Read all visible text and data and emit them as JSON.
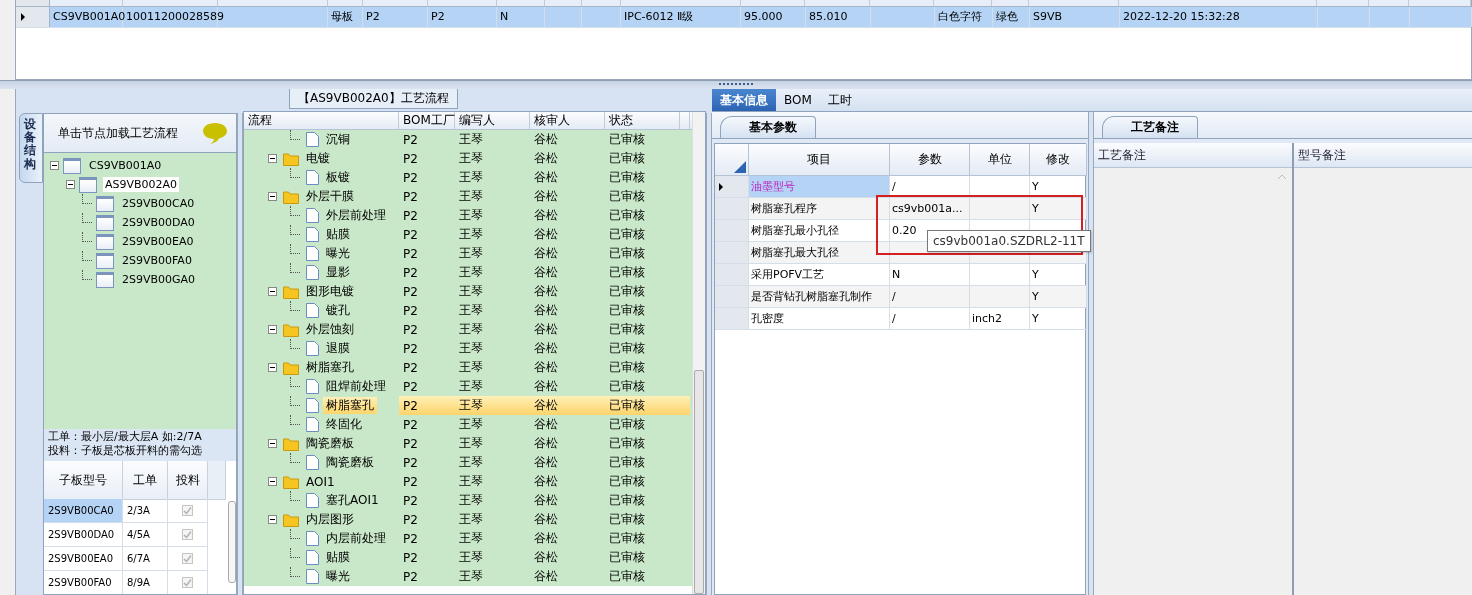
{
  "top_grid": {
    "rows": [
      {
        "selected": true,
        "cells": [
          "CS9VB001A0",
          "10011200028589",
          null,
          "母板",
          "P2",
          "P2",
          "N",
          null,
          null,
          "IPC-6012 Ⅱ级",
          "95.000",
          "85.010",
          null,
          "白色字符",
          "绿色",
          "S9VB",
          "2022-12-20 15:32:28",
          null,
          null,
          null
        ]
      }
    ]
  },
  "side_tab": {
    "label": "设备结构"
  },
  "structure": {
    "hint": "单击节点加载工艺流程",
    "tree": [
      {
        "label": "CS9VB001A0",
        "expanded": true,
        "selected": false,
        "children": [
          {
            "label": "AS9VB002A0",
            "expanded": true,
            "selected": true,
            "children": [
              {
                "label": "2S9VB00CA0",
                "selected": false
              },
              {
                "label": "2S9VB00DA0",
                "selected": false
              },
              {
                "label": "2S9VB00EA0",
                "selected": false
              },
              {
                "label": "2S9VB00FA0",
                "selected": false
              },
              {
                "label": "2S9VB00GA0",
                "selected": false
              }
            ]
          }
        ]
      }
    ],
    "notes": [
      "工单：最小层/最大层A 如:2/7A",
      "投料：子板是芯板开料的需勾选"
    ]
  },
  "sub_boards": {
    "columns": [
      "子板型号",
      "工单",
      "投料"
    ],
    "rows": [
      {
        "model": "2S9VB00CA0",
        "work_order": "2/3A",
        "checked": true,
        "selected": true
      },
      {
        "model": "2S9VB00DA0",
        "work_order": "4/5A",
        "checked": true,
        "selected": false
      },
      {
        "model": "2S9VB00EA0",
        "work_order": "6/7A",
        "checked": true,
        "selected": false
      },
      {
        "model": "2S9VB00FA0",
        "work_order": "8/9A",
        "checked": true,
        "selected": false
      }
    ]
  },
  "flow": {
    "title": "【AS9VB002A0】工艺流程",
    "columns": [
      "流程",
      "BOM工厂",
      "编写人",
      "核审人",
      "状态"
    ],
    "groups": [
      {
        "children": [
          {
            "name": "沉铜",
            "bom": "P2",
            "writer": "王琴",
            "reviewer": "谷松",
            "status": "已审核",
            "selected": false
          }
        ]
      },
      {
        "name": "电镀",
        "bom": "P2",
        "writer": "王琴",
        "reviewer": "谷松",
        "status": "已审核",
        "expanded": true,
        "selected": false,
        "children": [
          {
            "name": "板镀",
            "bom": "P2",
            "writer": "王琴",
            "reviewer": "谷松",
            "status": "已审核",
            "selected": false
          }
        ]
      },
      {
        "name": "外层干膜",
        "bom": "P2",
        "writer": "王琴",
        "reviewer": "谷松",
        "status": "已审核",
        "expanded": true,
        "selected": false,
        "children": [
          {
            "name": "外层前处理",
            "bom": "P2",
            "writer": "王琴",
            "reviewer": "谷松",
            "status": "已审核",
            "selected": false
          },
          {
            "name": "贴膜",
            "bom": "P2",
            "writer": "王琴",
            "reviewer": "谷松",
            "status": "已审核",
            "selected": false
          },
          {
            "name": "曝光",
            "bom": "P2",
            "writer": "王琴",
            "reviewer": "谷松",
            "status": "已审核",
            "selected": false
          },
          {
            "name": "显影",
            "bom": "P2",
            "writer": "王琴",
            "reviewer": "谷松",
            "status": "已审核",
            "selected": false
          }
        ]
      },
      {
        "name": "图形电镀",
        "bom": "P2",
        "writer": "王琴",
        "reviewer": "谷松",
        "status": "已审核",
        "expanded": true,
        "selected": false,
        "children": [
          {
            "name": "镀孔",
            "bom": "P2",
            "writer": "王琴",
            "reviewer": "谷松",
            "status": "已审核",
            "selected": false
          }
        ]
      },
      {
        "name": "外层蚀刻",
        "bom": "P2",
        "writer": "王琴",
        "reviewer": "谷松",
        "status": "已审核",
        "expanded": true,
        "selected": false,
        "children": [
          {
            "name": "退膜",
            "bom": "P2",
            "writer": "王琴",
            "reviewer": "谷松",
            "status": "已审核",
            "selected": false
          }
        ]
      },
      {
        "name": "树脂塞孔",
        "bom": "P2",
        "writer": "王琴",
        "reviewer": "谷松",
        "status": "已审核",
        "expanded": true,
        "selected": false,
        "children": [
          {
            "name": "阻焊前处理",
            "bom": "P2",
            "writer": "王琴",
            "reviewer": "谷松",
            "status": "已审核",
            "selected": false
          },
          {
            "name": "树脂塞孔",
            "bom": "P2",
            "writer": "王琴",
            "reviewer": "谷松",
            "status": "已审核",
            "selected": true
          },
          {
            "name": "终固化",
            "bom": "P2",
            "writer": "王琴",
            "reviewer": "谷松",
            "status": "已审核",
            "selected": false
          }
        ]
      },
      {
        "name": "陶瓷磨板",
        "bom": "P2",
        "writer": "王琴",
        "reviewer": "谷松",
        "status": "已审核",
        "expanded": true,
        "selected": false,
        "children": [
          {
            "name": "陶瓷磨板",
            "bom": "P2",
            "writer": "王琴",
            "reviewer": "谷松",
            "status": "已审核",
            "selected": false
          }
        ]
      },
      {
        "name": "AOI1",
        "bom": "P2",
        "writer": "王琴",
        "reviewer": "谷松",
        "status": "已审核",
        "expanded": true,
        "selected": false,
        "children": [
          {
            "name": "塞孔AOI1",
            "bom": "P2",
            "writer": "王琴",
            "reviewer": "谷松",
            "status": "已审核",
            "selected": false
          }
        ]
      },
      {
        "name": "内层图形",
        "bom": "P2",
        "writer": "王琴",
        "reviewer": "谷松",
        "status": "已审核",
        "expanded": true,
        "selected": false,
        "children": [
          {
            "name": "内层前处理",
            "bom": "P2",
            "writer": "王琴",
            "reviewer": "谷松",
            "status": "已审核",
            "selected": false
          },
          {
            "name": "贴膜",
            "bom": "P2",
            "writer": "王琴",
            "reviewer": "谷松",
            "status": "已审核",
            "selected": false
          },
          {
            "name": "曝光",
            "bom": "P2",
            "writer": "王琴",
            "reviewer": "谷松",
            "status": "已审核",
            "selected": false
          }
        ]
      }
    ]
  },
  "tabs": [
    {
      "label": "基本信息",
      "selected": true
    },
    {
      "label": "BOM",
      "selected": false
    },
    {
      "label": "工时",
      "selected": false
    }
  ],
  "params": {
    "tab": "基本参数",
    "columns": [
      "项目",
      "参数",
      "单位",
      "修改"
    ],
    "rows": [
      {
        "item": "油墨型号",
        "value": "/",
        "editable": "Y",
        "selected": true,
        "emphasized": true
      },
      {
        "item": "树脂塞孔程序",
        "value": "cs9vb001a...",
        "editable": "Y",
        "selected": false,
        "emphasized": false
      },
      {
        "item": "树脂塞孔最小孔径",
        "value": "0.20",
        "selected": false,
        "emphasized": false
      },
      {
        "item": "树脂塞孔最大孔径",
        "selected": false,
        "emphasized": false
      },
      {
        "item": "采用POFV工艺",
        "value": "N",
        "editable": "Y",
        "selected": false,
        "emphasized": false
      },
      {
        "item": "是否背钻孔树脂塞孔制作",
        "value": "/",
        "editable": "Y",
        "selected": false,
        "emphasized": false
      },
      {
        "item": "孔密度",
        "value": "/",
        "unit": "inch2",
        "editable": "Y",
        "selected": false,
        "emphasized": false
      }
    ],
    "tooltip": "cs9vb001a0.SZDRL2-11T"
  },
  "remarks": {
    "tab": "工艺备注",
    "columns": [
      "工艺备注",
      "型号备注"
    ]
  }
}
